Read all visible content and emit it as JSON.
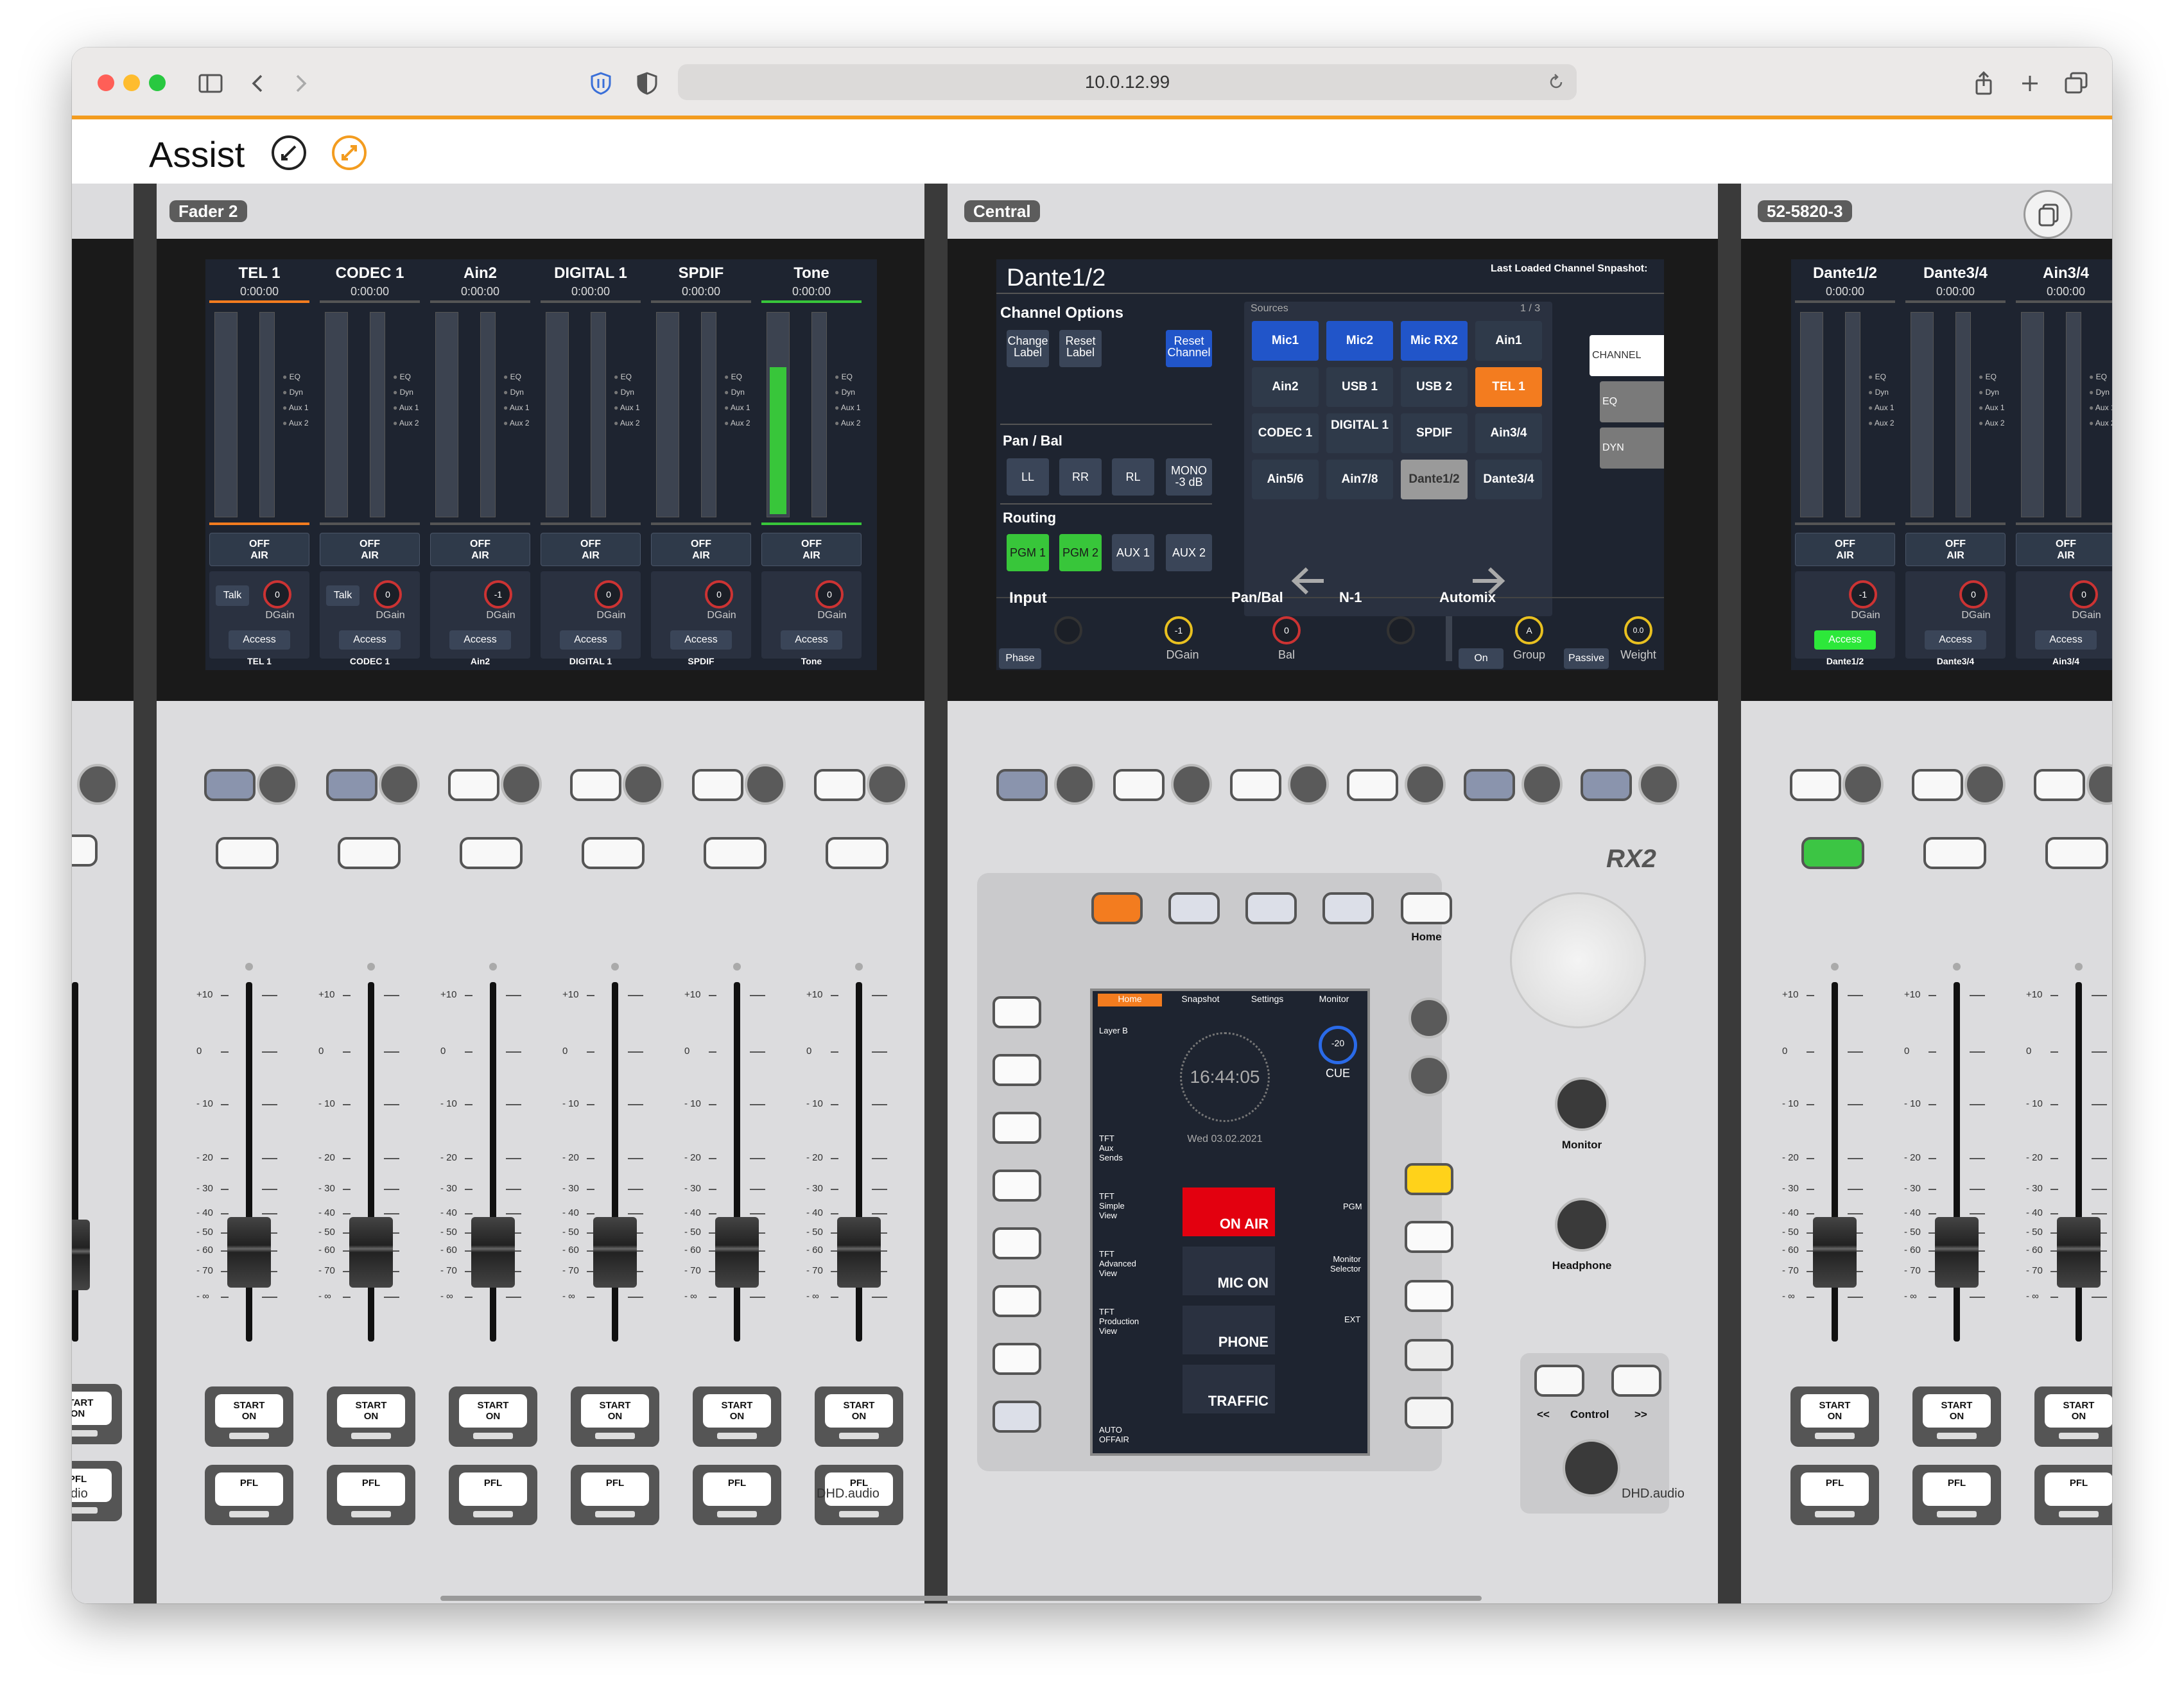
{
  "browser": {
    "url": "10.0.12.99"
  },
  "header": {
    "title": "Assist",
    "collapse_icon": "collapse-icon",
    "expand_icon": "expand-icon",
    "copy_icon": "copy-icon"
  },
  "modules": {
    "left_partial": {
      "start_labels": [
        "START",
        "ON"
      ],
      "pfl_label": "PFL",
      "brand": "dio"
    },
    "fader2": {
      "label": "Fader 2",
      "channels": [
        {
          "name": "TEL 1",
          "time": "0:00:00",
          "foot": "TEL 1",
          "talk": "Talk",
          "gain": "0",
          "dgain": "DGain",
          "access": "Access",
          "offair": [
            "OFF",
            "AIR"
          ]
        },
        {
          "name": "CODEC 1",
          "time": "0:00:00",
          "foot": "CODEC 1",
          "talk": "Talk",
          "gain": "0",
          "dgain": "DGain",
          "access": "Access",
          "offair": [
            "OFF",
            "AIR"
          ]
        },
        {
          "name": "Ain2",
          "time": "0:00:00",
          "foot": "Ain2",
          "talk": "",
          "gain": "-1",
          "dgain": "DGain",
          "access": "Access",
          "offair": [
            "OFF",
            "AIR"
          ]
        },
        {
          "name": "DIGITAL 1",
          "time": "0:00:00",
          "foot": "DIGITAL 1",
          "talk": "",
          "gain": "0",
          "dgain": "DGain",
          "access": "Access",
          "offair": [
            "OFF",
            "AIR"
          ]
        },
        {
          "name": "SPDIF",
          "time": "0:00:00",
          "foot": "SPDIF",
          "talk": "",
          "gain": "0",
          "dgain": "DGain",
          "access": "Access",
          "offair": [
            "OFF",
            "AIR"
          ]
        },
        {
          "name": "Tone",
          "time": "0:00:00",
          "foot": "Tone",
          "talk": "",
          "gain": "0",
          "dgain": "DGain",
          "access": "Access",
          "offair": [
            "OFF",
            "AIR"
          ],
          "meter_level": 0.74
        }
      ],
      "meter_legend": [
        "EQ",
        "Dyn",
        "Aux 1",
        "Aux 2"
      ],
      "meter_scale": [
        "+10",
        "0",
        "-10",
        "-20",
        "-30",
        "-40",
        "-60"
      ],
      "fader_scale": [
        "+10",
        "0",
        "- 10",
        "- 20",
        "- 30",
        "- 40",
        "- 50",
        "- 60",
        "- 70",
        "- ∞"
      ],
      "start_labels": [
        "START",
        "ON"
      ],
      "pfl_label": "PFL",
      "brand": "DHD.audio"
    },
    "central": {
      "label": "Central",
      "screen": {
        "title": "Dante1/2",
        "snapshot_label": "Last Loaded Channel Snpashot:",
        "channel_options_label": "Channel Options",
        "change_label": [
          "Change",
          "Label"
        ],
        "reset_label": [
          "Reset",
          "Label"
        ],
        "reset_channel": [
          "Reset",
          "Channel"
        ],
        "pan_bal_label": "Pan / Bal",
        "pan_buttons": [
          "LL",
          "RR",
          "RL"
        ],
        "mono_button": [
          "MONO",
          "-3 dB"
        ],
        "routing_label": "Routing",
        "routing_buttons": [
          "PGM 1",
          "PGM 2",
          "AUX 1",
          "AUX 2"
        ],
        "sources_label": "Sources",
        "sources_page": "1 / 3",
        "sources": [
          "Mic1",
          "Mic2",
          "Mic RX2",
          "Ain1",
          "Ain2",
          "USB 1",
          "USB 2",
          "TEL 1",
          "CODEC 1",
          "DIGITAL 1",
          "SPDIF",
          "Ain3/4",
          "Ain5/6",
          "Ain7/8",
          "Dante1/2",
          "Dante3/4"
        ],
        "tabs": [
          "CHANNEL",
          "EQ",
          "DYN"
        ],
        "input_label": "Input",
        "phase_label": "Phase",
        "dgain_value": "-1",
        "dgain_label": "DGain",
        "panbal_label": "Pan/Bal",
        "bal_value": "0",
        "bal_label": "Bal",
        "n1_label": "N-1",
        "automix_label": "Automix",
        "on_label": "On",
        "group_value": "A",
        "group_label": "Group",
        "passive_label": "Passive",
        "weight_value": "0.0",
        "weight_label": "Weight"
      },
      "rx2_label": "RX2",
      "home_label": "Home",
      "tft": {
        "tabs": [
          "Home",
          "Snapshot",
          "Settings",
          "Monitor"
        ],
        "layer": "Layer B",
        "time": "16:44:05",
        "date": "Wed 03.02.2021",
        "cue_value": "-20",
        "cue_label": "CUE",
        "aux_sends": [
          "TFT",
          "Aux",
          "Sends"
        ],
        "simple_view": [
          "TFT",
          "Simple",
          "View"
        ],
        "advanced_view": [
          "TFT",
          "Advanced",
          "View"
        ],
        "production_view": [
          "TFT",
          "Production",
          "View"
        ],
        "auto_offair": [
          "AUTO",
          "OFFAIR"
        ],
        "pgm": "PGM",
        "monitor_selector": [
          "Monitor",
          "Selector"
        ],
        "ext": "EXT",
        "on_air": "ON AIR",
        "mic_on": "MIC ON",
        "phone": "PHONE",
        "traffic": "TRAFFIC"
      },
      "monitor_label": "Monitor",
      "headphone_label": "Headphone",
      "control_label": "Control",
      "control_prev": "<<",
      "control_next": ">>",
      "brand": "DHD.audio"
    },
    "right": {
      "label": "52-5820-3",
      "channels": [
        {
          "name": "Dante1/2",
          "time": "0:00:00",
          "foot": "Dante1/2",
          "gain": "-1",
          "dgain": "DGain",
          "access": "Access",
          "offair": [
            "OFF",
            "AIR"
          ]
        },
        {
          "name": "Dante3/4",
          "time": "0:00:00",
          "foot": "Dante3/4",
          "gain": "0",
          "dgain": "DGain",
          "access": "Access",
          "offair": [
            "OFF",
            "AIR"
          ]
        },
        {
          "name": "Ain3/4",
          "time": "0:00:00",
          "foot": "Ain3/4",
          "gain": "0",
          "dgain": "DGain",
          "access": "Access",
          "offair": [
            "OFF",
            "AIR"
          ]
        }
      ],
      "start_labels": [
        "START",
        "ON"
      ],
      "pfl_label": "PFL"
    }
  },
  "colors": {
    "accent": "#f39c1f",
    "screen": "#1e2430",
    "active_green": "#38c63a",
    "source_blue": "#2155c9",
    "onair_red": "#e3000f",
    "pgm_yellow": "#ffd21a"
  }
}
